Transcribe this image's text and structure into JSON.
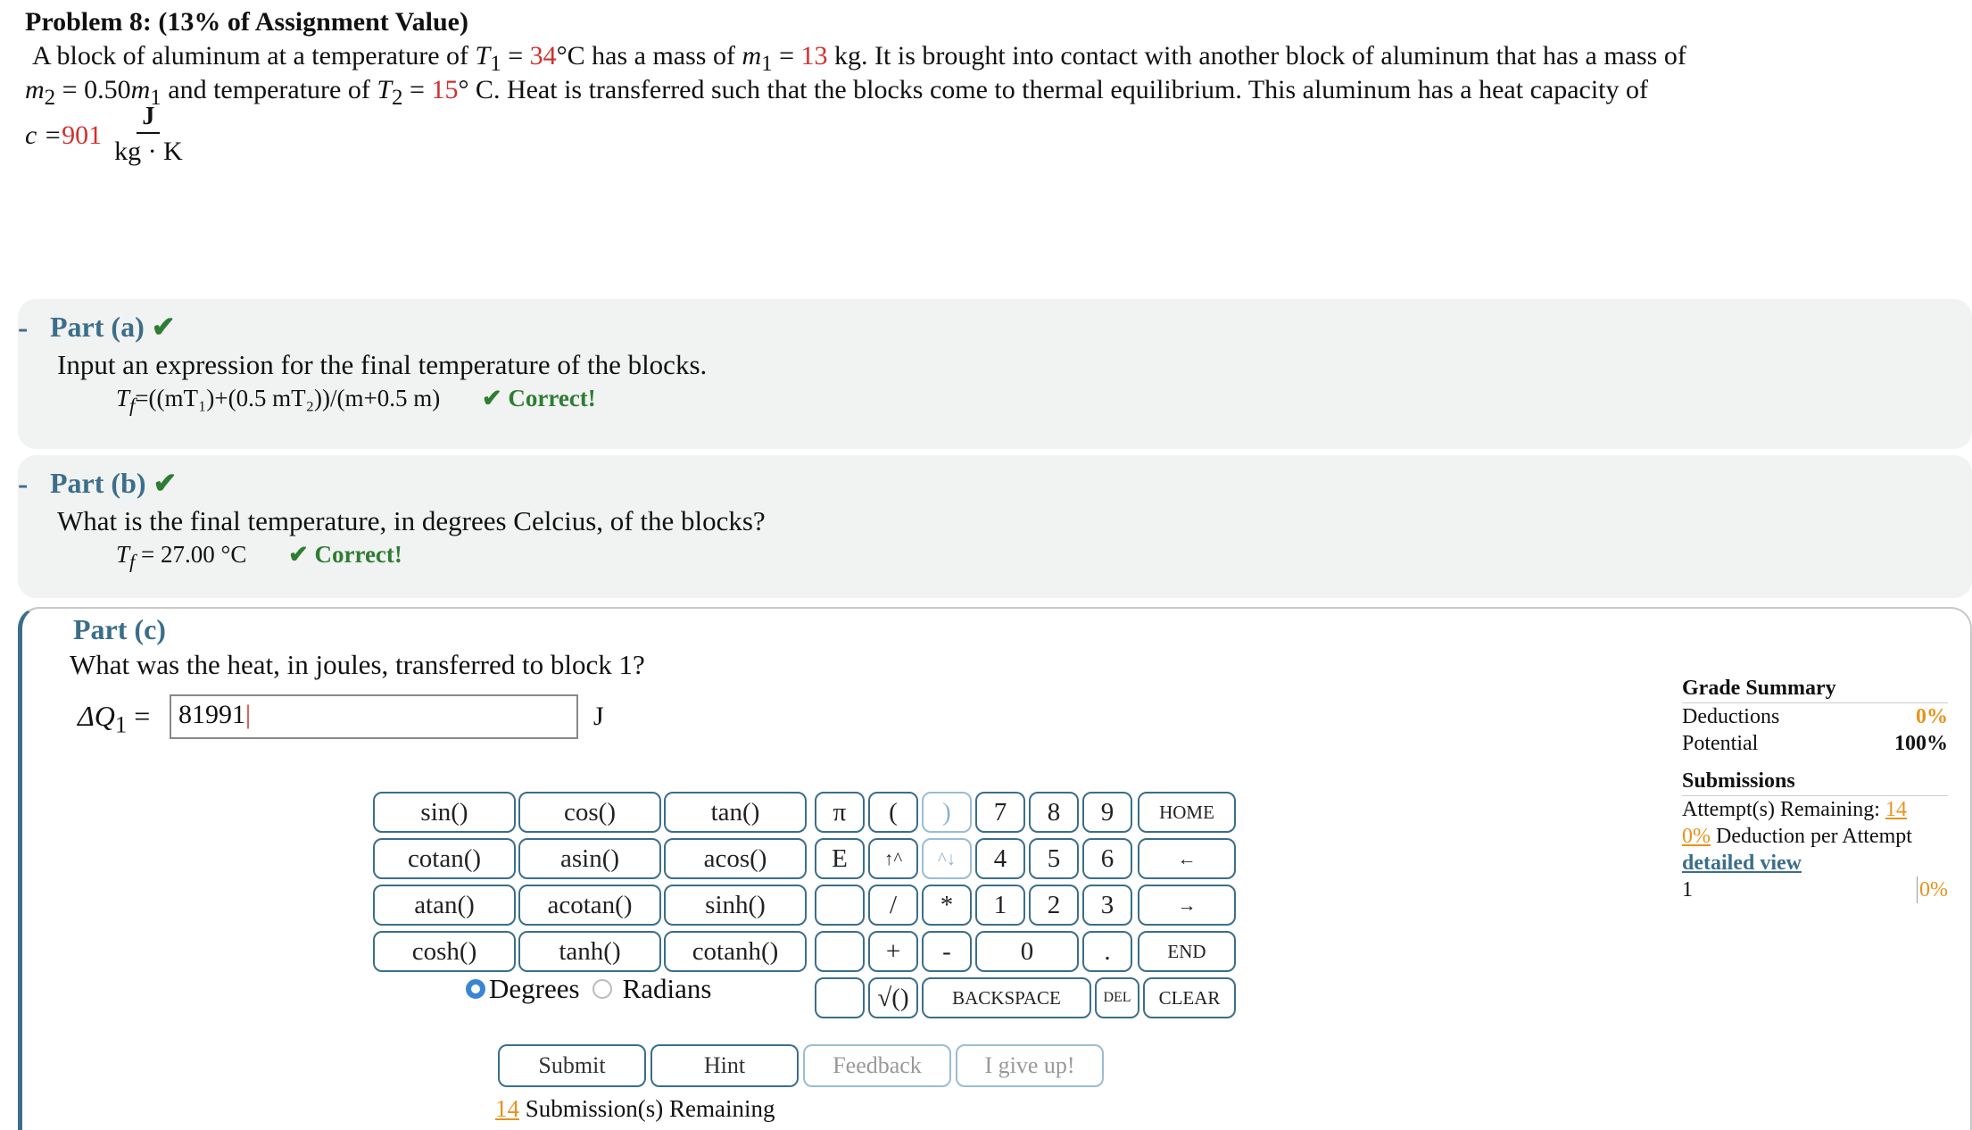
{
  "problem": {
    "header": "Problem 8: (13% of Assignment Value)",
    "line1_pre": "A block of aluminum at a temperature of ",
    "t1_sym": "T",
    "t1_sub": "1",
    "t1_val": "34",
    "t1_unit": "°C has a mass of ",
    "m1_sym": "m",
    "m1_sub": "1",
    "m1_val": "13",
    "line1_post": "kg. It is brought into contact with another block of aluminum that has a mass of",
    "m2_sym": "m",
    "m2_sub": "2",
    "m2_expr": " = 0.50",
    "m2_rest": " and temperature of ",
    "t2_sym": "T",
    "t2_sub": "2",
    "t2_val": "15",
    "line2_post": "° C. Heat is transferred such that the blocks come to thermal equilibrium. This aluminum has a heat capacity of",
    "c_sym": "c = ",
    "c_val": "901",
    "c_num": "J",
    "c_den": "kg · K"
  },
  "part_a": {
    "dash": "-",
    "title": "Part (a)",
    "check": "✔",
    "question": "Input an expression for the final temperature of the blocks.",
    "answer": "=((mT₁)+(0.5 mT₂))/(m+0.5 m)",
    "answer_sym": "T",
    "answer_sub": "f",
    "correct": "✔ Correct!"
  },
  "part_b": {
    "dash": "-",
    "title": "Part (b)",
    "check": "✔",
    "question": "What is the final temperature, in degrees Celcius, of the blocks?",
    "answer_sym": "T",
    "answer_sub": "f",
    "answer": " = 27.00 °C",
    "correct": "✔ Correct!"
  },
  "part_c": {
    "title": "Part (c)",
    "question": "What was the heat, in joules, transferred to block 1?",
    "label_sym": "ΔQ",
    "label_sub": "1",
    "label_eq": " = ",
    "input_value": "81991",
    "unit": "J"
  },
  "keypad": {
    "func": [
      "sin()",
      "cos()",
      "tan()",
      "cotan()",
      "asin()",
      "acos()",
      "atan()",
      "acotan()",
      "sinh()",
      "cosh()",
      "tanh()",
      "cotanh()"
    ],
    "col_a": [
      "π",
      "E",
      "",
      ""
    ],
    "col_b": [
      "(",
      "↑^",
      "/",
      "+"
    ],
    "col_c": [
      ")",
      "^↓",
      "*",
      "-"
    ],
    "digits": [
      "7",
      "8",
      "9",
      "4",
      "5",
      "6",
      "1",
      "2",
      "3",
      "0",
      "."
    ],
    "nav": [
      "HOME",
      "←",
      "→",
      "END"
    ],
    "sqrt": "√()",
    "backspace": "BACKSPACE",
    "del": "DEL",
    "clear": "CLEAR",
    "degrees": "Degrees",
    "radians": "Radians",
    "angle_mode": "Degrees"
  },
  "actions": {
    "submit": "Submit",
    "hint": "Hint",
    "feedback": "Feedback",
    "give_up": "I give up!",
    "remaining_count": "14",
    "remaining_text": " Submission(s) Remaining"
  },
  "grade_summary": {
    "title": "Grade Summary",
    "deductions_label": "Deductions",
    "deductions_value": "0%",
    "potential_label": "Potential",
    "potential_value": "100%",
    "submissions_title": "Submissions",
    "attempts_label": "Attempt(s) Remaining: ",
    "attempts_value": "14",
    "deduction_pct": "0%",
    "deduction_text": " Deduction per Attempt",
    "detailed_view": "detailed view",
    "row_index": "1",
    "row_value": "0%"
  },
  "colors": {
    "accent": "#3b6e8a",
    "given_value": "#d32f2f",
    "correct": "#2e7d32",
    "highlight": "#e8921a",
    "panel_bg": "#f1f2f2"
  }
}
